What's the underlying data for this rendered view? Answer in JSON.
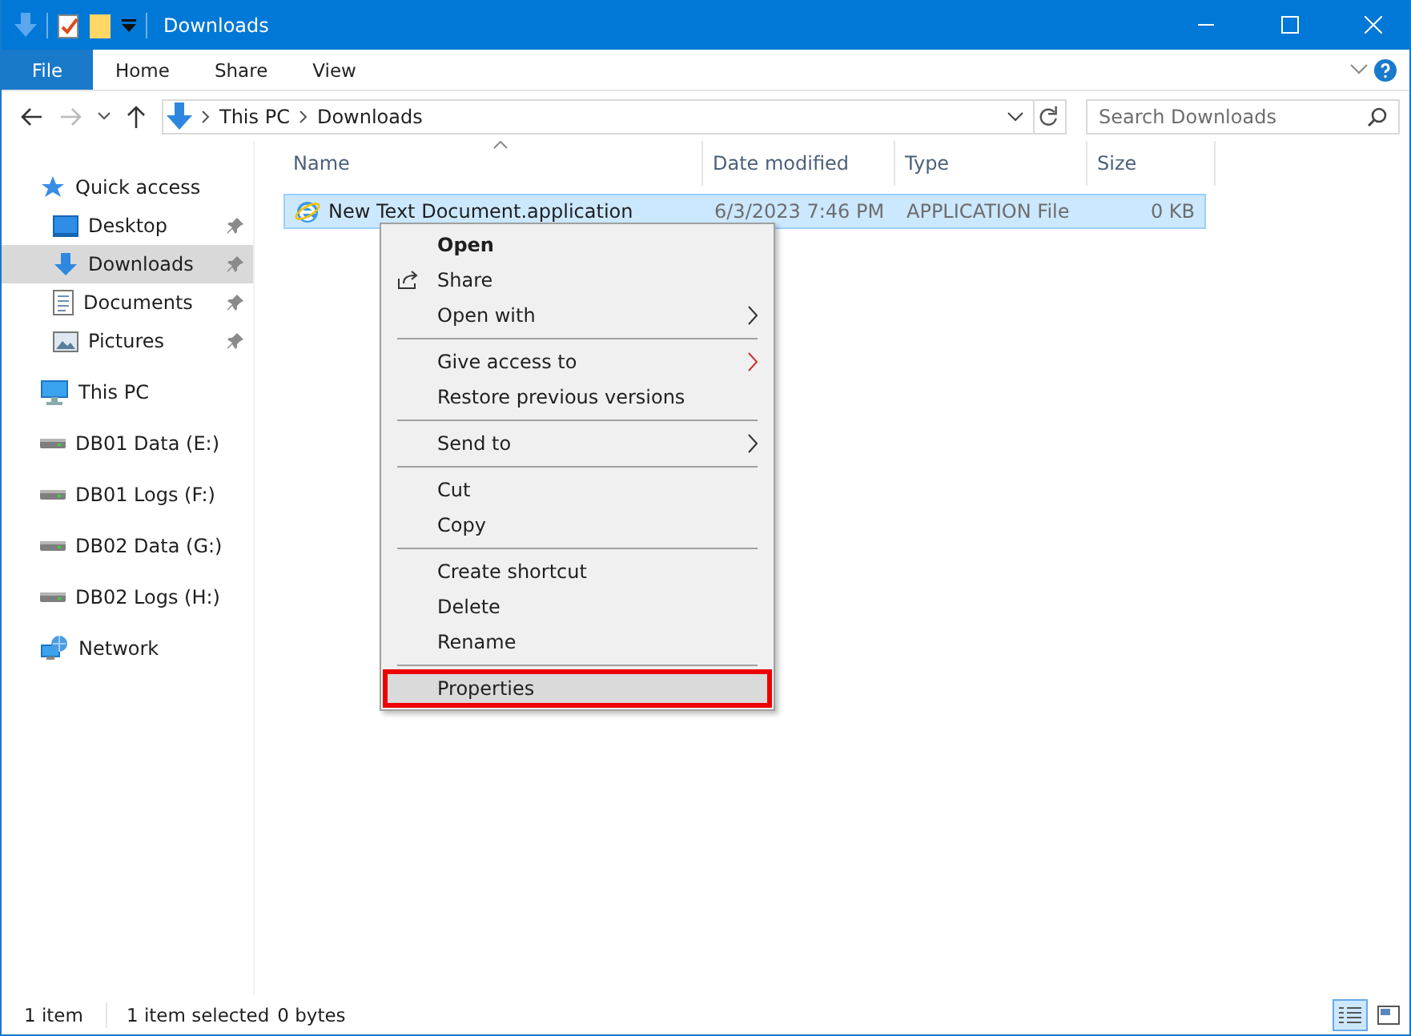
{
  "window": {
    "title": "Downloads"
  },
  "ribbon_tabs": [
    {
      "label": "File",
      "kind": "file"
    },
    {
      "label": "Home",
      "kind": "tab"
    },
    {
      "label": "Share",
      "kind": "tab"
    },
    {
      "label": "View",
      "kind": "tab"
    }
  ],
  "address_bar": {
    "path": [
      "This PC",
      "Downloads"
    ]
  },
  "search": {
    "placeholder": "Search Downloads"
  },
  "sidebar": {
    "items": [
      {
        "label": "Quick access",
        "kind": "star",
        "selected": false,
        "children": [
          {
            "label": "Desktop",
            "kind": "desktop",
            "selected": false,
            "pinned": true
          },
          {
            "label": "Downloads",
            "kind": "download",
            "selected": true,
            "pinned": true
          },
          {
            "label": "Documents",
            "kind": "document",
            "selected": false,
            "pinned": true
          },
          {
            "label": "Pictures",
            "kind": "pictures",
            "selected": false,
            "pinned": true
          }
        ]
      },
      {
        "label": "This PC",
        "kind": "computer",
        "selected": false
      },
      {
        "label": "DB01 Data (E:)",
        "kind": "drive",
        "selected": false
      },
      {
        "label": "DB01 Logs (F:)",
        "kind": "drive",
        "selected": false
      },
      {
        "label": "DB02 Data (G:)",
        "kind": "drive",
        "selected": false
      },
      {
        "label": "DB02 Logs (H:)",
        "kind": "drive",
        "selected": false
      },
      {
        "label": "Network",
        "kind": "network",
        "selected": false
      }
    ]
  },
  "table": {
    "columns": [
      {
        "label": "Name",
        "sorted": true
      },
      {
        "label": "Date modified",
        "sorted": false
      },
      {
        "label": "Type",
        "sorted": false
      },
      {
        "label": "Size",
        "sorted": false
      }
    ],
    "rows": [
      {
        "name": "New Text Document.application",
        "date_modified": "6/3/2023 7:46 PM",
        "type": "APPLICATION File",
        "size": "0 KB",
        "selected": true
      }
    ]
  },
  "context_menu": {
    "groups": [
      [
        {
          "label": "Open",
          "bold": true,
          "has_icon": false,
          "submenu": false,
          "highlighted": false
        },
        {
          "label": "Share",
          "bold": false,
          "has_icon": true,
          "submenu": false,
          "highlighted": false
        },
        {
          "label": "Open with",
          "bold": false,
          "has_icon": false,
          "submenu": true,
          "highlighted": false
        }
      ],
      [
        {
          "label": "Give access to",
          "bold": false,
          "has_icon": false,
          "submenu": true,
          "highlighted": false
        },
        {
          "label": "Restore previous versions",
          "bold": false,
          "has_icon": false,
          "submenu": false,
          "highlighted": false
        }
      ],
      [
        {
          "label": "Send to",
          "bold": false,
          "has_icon": false,
          "submenu": true,
          "highlighted": false
        }
      ],
      [
        {
          "label": "Cut",
          "bold": false,
          "has_icon": false,
          "submenu": false,
          "highlighted": false
        },
        {
          "label": "Copy",
          "bold": false,
          "has_icon": false,
          "submenu": false,
          "highlighted": false
        }
      ],
      [
        {
          "label": "Create shortcut",
          "bold": false,
          "has_icon": false,
          "submenu": false,
          "highlighted": false
        },
        {
          "label": "Delete",
          "bold": false,
          "has_icon": false,
          "submenu": false,
          "highlighted": false
        },
        {
          "label": "Rename",
          "bold": false,
          "has_icon": false,
          "submenu": false,
          "highlighted": false
        }
      ],
      [
        {
          "label": "Properties",
          "bold": false,
          "has_icon": false,
          "submenu": false,
          "highlighted": true
        }
      ]
    ]
  },
  "status_bar": {
    "item_count": "1 item",
    "selection": "1 item selected",
    "size": "0 bytes"
  },
  "view_buttons": [
    {
      "kind": "details",
      "selected": true
    },
    {
      "kind": "tiles",
      "selected": false
    }
  ]
}
